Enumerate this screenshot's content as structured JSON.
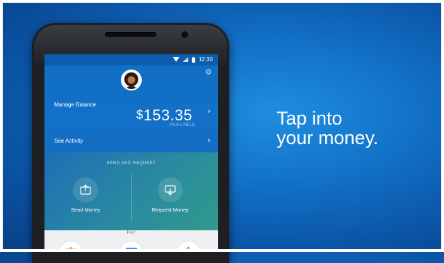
{
  "status_bar": {
    "time": "12:30"
  },
  "balance": {
    "label": "Manage Balance",
    "currency": "$",
    "amount": "153.35",
    "available_label": "AVAILABLE"
  },
  "activity": {
    "label": "See Activity"
  },
  "send_request": {
    "title": "SEND AND REQUEST",
    "send_label": "Send Money",
    "request_label": "Request Money"
  },
  "pay": {
    "title": "PAY"
  },
  "tagline": {
    "line1": "Tap into",
    "line2": "your money."
  },
  "icons": [
    "wifi-icon",
    "signal-icon",
    "battery-icon",
    "avatar",
    "gear-icon",
    "chevron-right-icon",
    "send-money-icon",
    "request-money-icon"
  ],
  "colors": {
    "brand_blue": "#1270c8",
    "teal": "#2f9a8c",
    "background": "#1272c8"
  }
}
